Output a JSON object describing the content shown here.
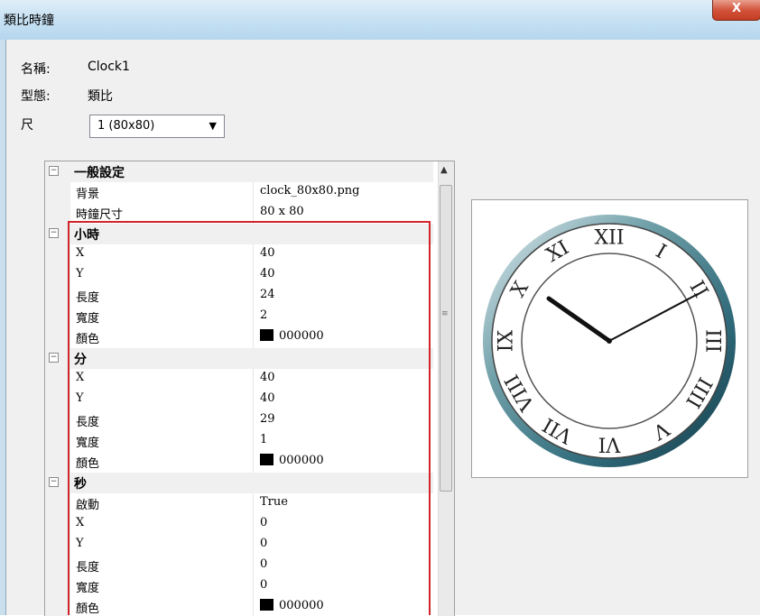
{
  "window": {
    "title": "類比時鐘",
    "close_label": "X"
  },
  "form": {
    "name_label": "名稱:",
    "name_value": "Clock1",
    "type_label": "型態:",
    "type_value": "類比",
    "size_label": "尺",
    "size_selected": "1  (80x80)"
  },
  "grid": {
    "categories": [
      {
        "label": "一般設定",
        "toggle": "−",
        "props": [
          {
            "name": "背景",
            "value": "clock_80x80.png"
          },
          {
            "name": "時鐘尺寸",
            "value": "80 x 80"
          }
        ]
      },
      {
        "label": "小時",
        "toggle": "−",
        "props": [
          {
            "name": "X",
            "value": "40"
          },
          {
            "name": "Y",
            "value": "40"
          },
          {
            "name": "長度",
            "value": "24"
          },
          {
            "name": "寬度",
            "value": "2"
          },
          {
            "name": "顏色",
            "value": "000000",
            "swatch": "#000000"
          }
        ]
      },
      {
        "label": "分",
        "toggle": "−",
        "props": [
          {
            "name": "X",
            "value": "40"
          },
          {
            "name": "Y",
            "value": "40"
          },
          {
            "name": "長度",
            "value": "29"
          },
          {
            "name": "寬度",
            "value": "1"
          },
          {
            "name": "顏色",
            "value": "000000",
            "swatch": "#000000"
          }
        ]
      },
      {
        "label": "秒",
        "toggle": "−",
        "props": [
          {
            "name": "啟動",
            "value": "True"
          },
          {
            "name": "X",
            "value": "0"
          },
          {
            "name": "Y",
            "value": "0"
          },
          {
            "name": "長度",
            "value": "0"
          },
          {
            "name": "寬度",
            "value": "0"
          },
          {
            "name": "顏色",
            "value": "000000",
            "swatch": "#000000"
          }
        ]
      }
    ]
  },
  "preview": {
    "numerals": [
      "XII",
      "I",
      "II",
      "III",
      "IIII",
      "V",
      "VI",
      "VII",
      "VIII",
      "IX",
      "X",
      "XI"
    ],
    "hour_hand_time": "10",
    "minute_hand_time": "10"
  },
  "colors": {
    "highlight_border": "#d1232b",
    "close_button": "#c53c22",
    "titlebar": "#c9e2f3"
  }
}
